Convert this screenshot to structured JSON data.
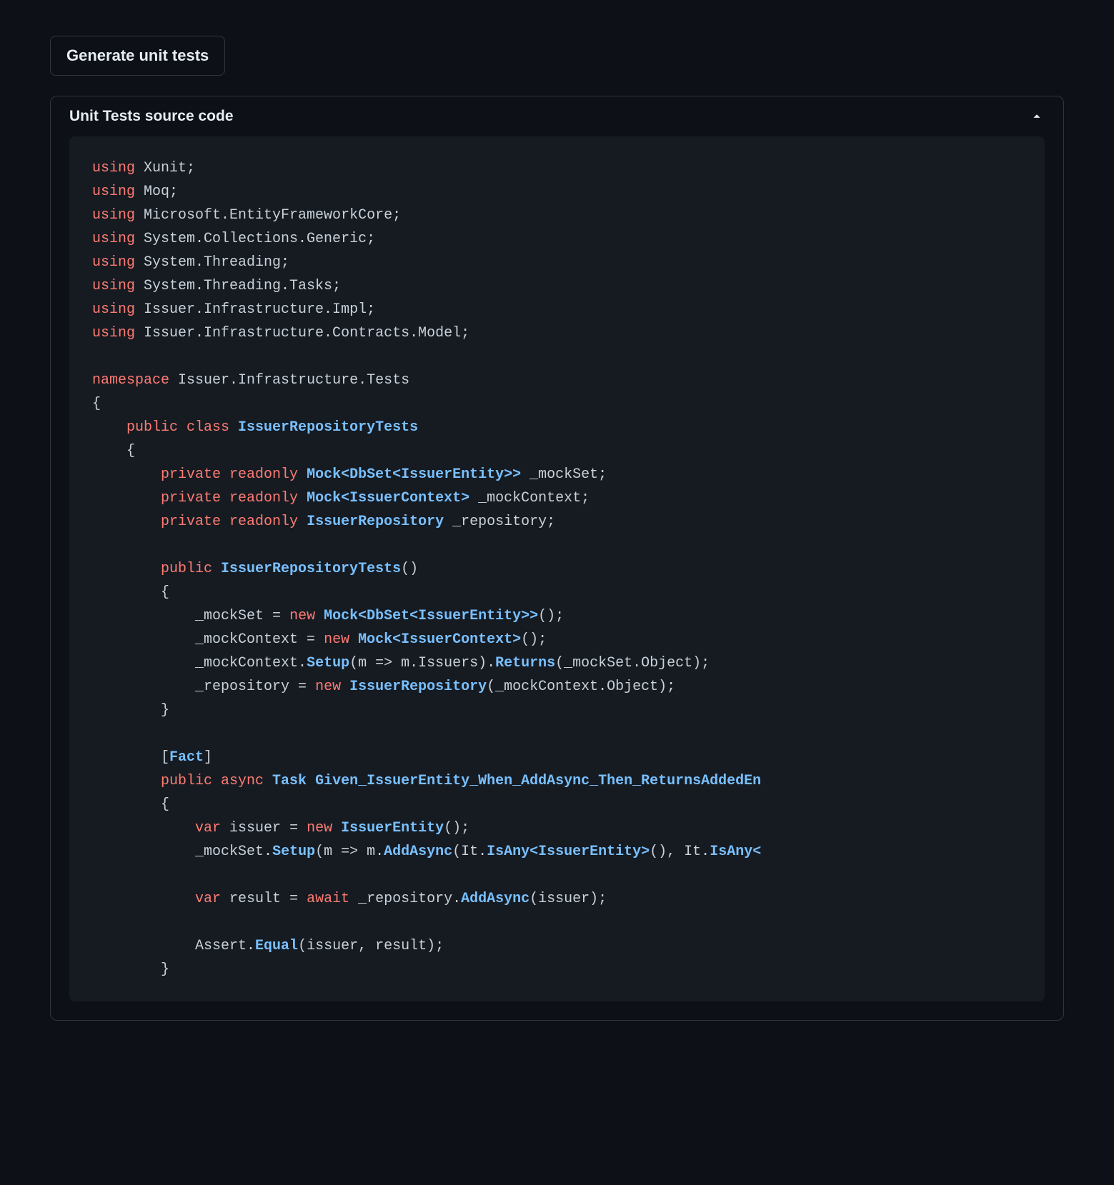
{
  "button": {
    "generate_label": "Generate unit tests"
  },
  "panel": {
    "title": "Unit Tests source code"
  },
  "code": {
    "l1_kw": "using",
    "l1_id": " Xunit;",
    "l2_kw": "using",
    "l2_id": " Moq;",
    "l3_kw": "using",
    "l3_id": " Microsoft.EntityFrameworkCore;",
    "l4_kw": "using",
    "l4_id": " System.Collections.Generic;",
    "l5_kw": "using",
    "l5_id": " System.Threading;",
    "l6_kw": "using",
    "l6_id": " System.Threading.Tasks;",
    "l7_kw": "using",
    "l7_id": " Issuer.Infrastructure.Impl;",
    "l8_kw": "using",
    "l8_id": " Issuer.Infrastructure.Contracts.Model;",
    "ns_kw": "namespace",
    "ns_id": " Issuer.Infrastructure.Tests",
    "open_brace": "{",
    "close_brace": "}",
    "cls_indent": "    ",
    "cls_kw1": "public",
    "cls_kw2": " class ",
    "cls_name": "IssuerRepositoryTests",
    "cls_open": "    {",
    "cls_close": "    }",
    "fld_indent": "        ",
    "fld_kw1": "private",
    "fld_kw2": " readonly ",
    "fld1_type": "Mock<DbSet<IssuerEntity>>",
    "fld1_name": " _mockSet;",
    "fld2_type": "Mock<IssuerContext>",
    "fld2_name": " _mockContext;",
    "fld3_type": "IssuerRepository",
    "fld3_name": " _repository;",
    "ctor_kw": "public ",
    "ctor_name": "IssuerRepositoryTests",
    "ctor_paren": "()",
    "ctor_open": "        {",
    "ctor_close": "        }",
    "body_indent": "            ",
    "c1_a": "_mockSet = ",
    "c1_new": "new ",
    "c1_type": "Mock<DbSet<IssuerEntity>>",
    "c1_end": "();",
    "c2_a": "_mockContext = ",
    "c2_new": "new ",
    "c2_type": "Mock<IssuerContext>",
    "c2_end": "();",
    "c3_a": "_mockContext.",
    "c3_setup": "Setup",
    "c3_b": "(m => m.Issuers).",
    "c3_ret": "Returns",
    "c3_c": "(_mockSet.Object);",
    "c4_a": "_repository = ",
    "c4_new": "new ",
    "c4_type": "IssuerRepository",
    "c4_end": "(_mockContext.Object);",
    "fact_open": "[",
    "fact_name": "Fact",
    "fact_close": "]",
    "m1_kw": "public async ",
    "m1_task": "Task ",
    "m1_name": "Given_IssuerEntity_When_AddAsync_Then_ReturnsAddedEn",
    "m1_open": "        {",
    "t1_var": "var",
    "t1_a": " issuer = ",
    "t1_new": "new ",
    "t1_type": "IssuerEntity",
    "t1_end": "();",
    "t2_a": "_mockSet.",
    "t2_setup": "Setup",
    "t2_b": "(m => m.",
    "t2_add": "AddAsync",
    "t2_c": "(It.",
    "t2_isany1": "IsAny<IssuerEntity>",
    "t2_d": "(), It.",
    "t2_isany2": "IsAny<",
    "t3_var": "var",
    "t3_a": " result = ",
    "t3_await": "await",
    "t3_b": " _repository.",
    "t3_add": "AddAsync",
    "t3_c": "(issuer);",
    "t4_a": "Assert.",
    "t4_eq": "Equal",
    "t4_b": "(issuer, result);",
    "m1_close": "        }"
  }
}
